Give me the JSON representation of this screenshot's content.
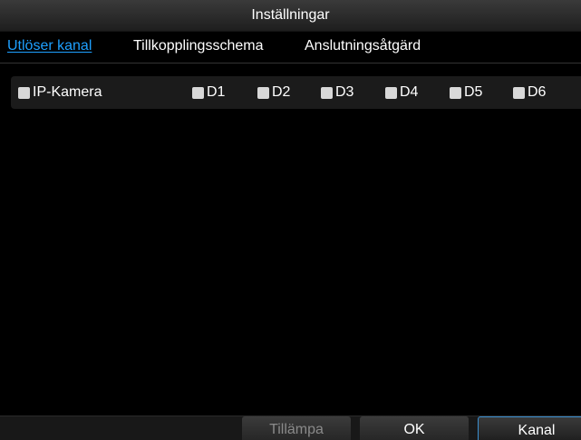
{
  "window": {
    "title": "Inställningar"
  },
  "tabs": [
    {
      "label": "Utlöser kanal",
      "active": true
    },
    {
      "label": "Tillkopplingsschema",
      "active": false
    },
    {
      "label": "Anslutningsåtgärd",
      "active": false
    }
  ],
  "channels": [
    {
      "label": "IP-Kamera",
      "checked": false
    },
    {
      "label": "D1",
      "checked": false
    },
    {
      "label": "D2",
      "checked": false
    },
    {
      "label": "D3",
      "checked": false
    },
    {
      "label": "D4",
      "checked": false
    },
    {
      "label": "D5",
      "checked": false
    },
    {
      "label": "D6",
      "checked": false
    }
  ],
  "footer": {
    "apply_label": "Tillämpa",
    "ok_label": "OK",
    "channel_label": "Kanal"
  },
  "colors": {
    "accent": "#1ea0ff",
    "background": "#000000",
    "checkbox": "#d8d8d8"
  }
}
